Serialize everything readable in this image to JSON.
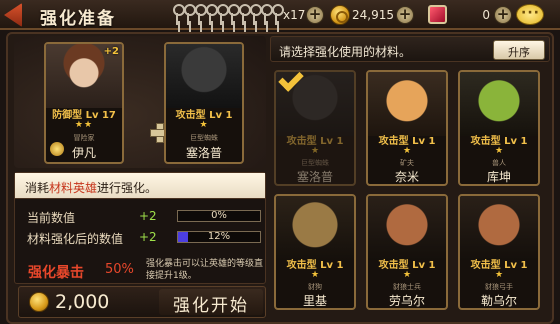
{
  "header": {
    "title": "强化准备",
    "keys_count": "x17",
    "coins": "24,915",
    "rubies": "0"
  },
  "hero": {
    "level_bonus": "+2",
    "type": "防御型 Lv 17",
    "stars": "★★",
    "class": "冒险家",
    "name": "伊凡"
  },
  "material_selected": {
    "type": "攻击型 Lv 1",
    "stars": "★",
    "class": "巨型蜘蛛",
    "name": "塞洛普"
  },
  "info": {
    "hint_prefix": "消耗",
    "hint_highlight": "材料英雄",
    "hint_suffix": "进行强化。",
    "current_label": "当前数值",
    "current_plus": "+2",
    "current_pct_text": "0%",
    "current_pct": 0,
    "after_label": "材料强化后的数值",
    "after_plus": "+2",
    "after_pct_text": "12%",
    "after_pct": 12,
    "crit_label": "强化暴击",
    "crit_value": "50%",
    "crit_desc": "强化暴击可以让英雄的等级直接提升1级。"
  },
  "bottom": {
    "cost": "2,000",
    "start_label": "强化开始"
  },
  "materials_panel": {
    "prompt": "请选择强化使用的材料。",
    "sort_label": "升序",
    "items": [
      {
        "type": "攻击型 Lv 1",
        "stars": "★",
        "class": "巨型蜘蛛",
        "name": "塞洛普"
      },
      {
        "type": "攻击型 Lv 1",
        "stars": "★",
        "class": "矿夫",
        "name": "奈米"
      },
      {
        "type": "攻击型 Lv 1",
        "stars": "★",
        "class": "兽人",
        "name": "库坤"
      },
      {
        "type": "攻击型 Lv 1",
        "stars": "★",
        "class": "豺狗",
        "name": "里基"
      },
      {
        "type": "攻击型 Lv 1",
        "stars": "★",
        "class": "豺狼士兵",
        "name": "劳乌尔"
      },
      {
        "type": "攻击型 Lv 1",
        "stars": "★",
        "class": "豺狼弓手",
        "name": "勒乌尔"
      }
    ]
  }
}
